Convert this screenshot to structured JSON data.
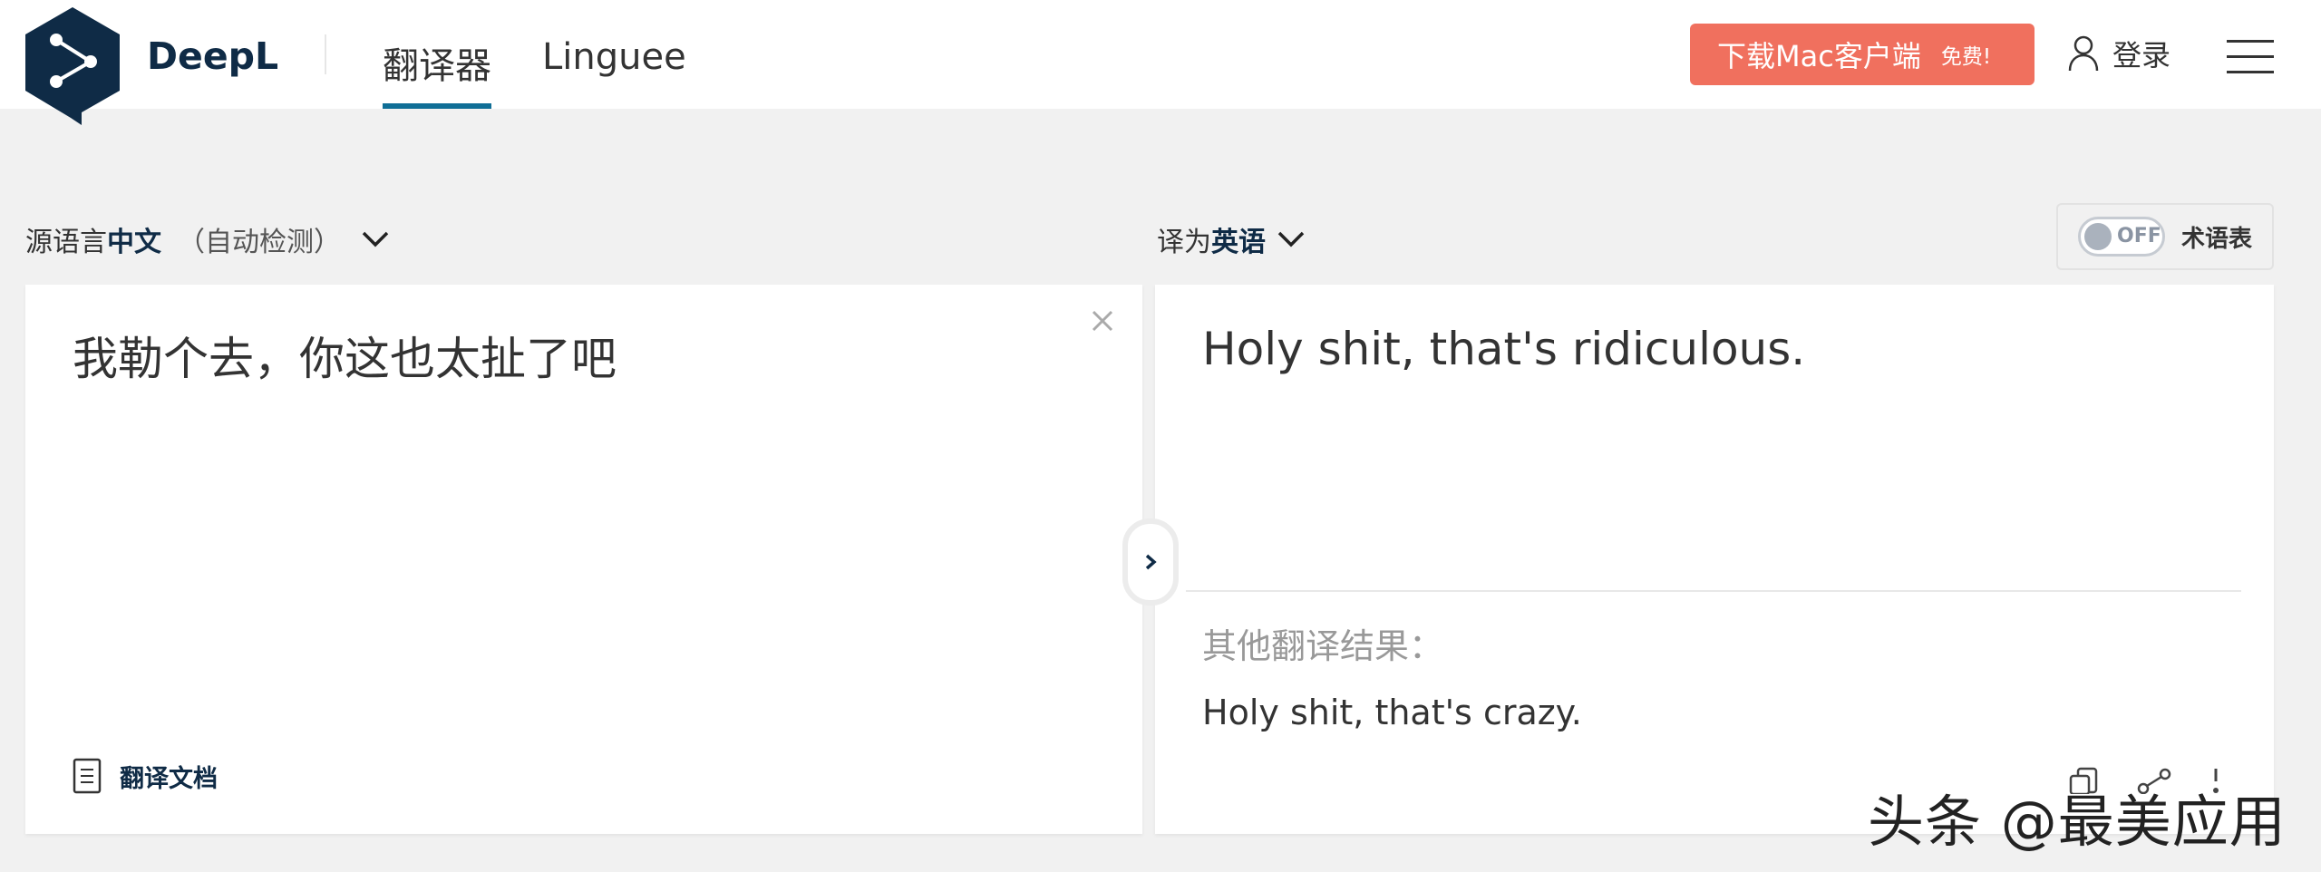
{
  "header": {
    "brand": "DeepL",
    "tabs": [
      {
        "label": "翻译器"
      },
      {
        "label": "Linguee"
      }
    ],
    "download_button": {
      "label": "下载Mac客户端",
      "badge": "免费!"
    },
    "login_label": "登录"
  },
  "language_bar": {
    "source_prefix": "源语言",
    "source_language": "中文",
    "source_auto": "（自动检测）",
    "target_prefix": "译为",
    "target_language": "英语",
    "glossary_toggle": "OFF",
    "glossary_label": "术语表"
  },
  "source_panel": {
    "text": "我勒个去，你这也太扯了吧",
    "translate_document_label": "翻译文档"
  },
  "target_panel": {
    "text": "Holy shit, that's ridiculous.",
    "alternatives_label": "其他翻译结果：",
    "alternatives": [
      "Holy shit, that's crazy."
    ]
  },
  "watermark": "头条 @最美应用",
  "colors": {
    "brand_navy": "#0f2b46",
    "accent_blue": "#0f6e96",
    "download_orange": "#f0705e",
    "background": "#f1f1f1"
  }
}
